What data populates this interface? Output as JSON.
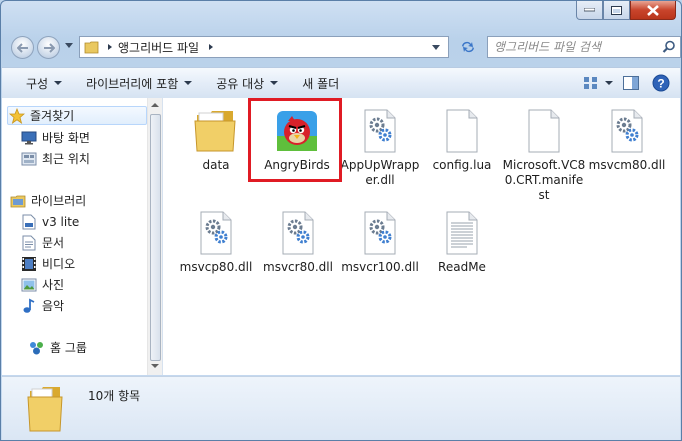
{
  "window": {
    "buttons": {
      "minimize": "minimize",
      "maximize": "maximize",
      "close": "close"
    }
  },
  "address": {
    "path_text": "앵그리버드 파일"
  },
  "search": {
    "placeholder": "앵그리버드 파일 검색"
  },
  "toolbar": {
    "organize": "구성",
    "include_in_library": "라이브러리에 포함",
    "share_with": "공유 대상",
    "new_folder": "새 폴더"
  },
  "sidebar": {
    "favorites": "즐겨찾기",
    "desktop": "바탕 화면",
    "recent_places": "최근 위치",
    "libraries": "라이브러리",
    "v3lite": "v3 lite",
    "documents": "문서",
    "videos": "비디오",
    "pictures": "사진",
    "music": "음악",
    "homegroup": "홈 그룹"
  },
  "files": [
    {
      "name": "data",
      "icon": "folder-icon"
    },
    {
      "name": "AngryBirds",
      "icon": "angrybirds-app-icon"
    },
    {
      "name": "AppUpWrapper.dll",
      "icon": "dll-gear-icon"
    },
    {
      "name": "config.lua",
      "icon": "blank-file-icon"
    },
    {
      "name": "Microsoft.VC80.CRT.manifest",
      "icon": "blank-file-icon"
    },
    {
      "name": "msvcm80.dll",
      "icon": "dll-gear-icon"
    },
    {
      "name": "msvcp80.dll",
      "icon": "dll-gear-icon"
    },
    {
      "name": "msvcr80.dll",
      "icon": "dll-gear-icon"
    },
    {
      "name": "msvcr100.dll",
      "icon": "dll-gear-icon"
    },
    {
      "name": "ReadMe",
      "icon": "text-file-icon"
    }
  ],
  "status": {
    "item_count": "10개 항목"
  },
  "colors": {
    "highlight_box": "#e01b24",
    "title_bar": "#b9d1ea",
    "close_button": "#c9452c"
  }
}
